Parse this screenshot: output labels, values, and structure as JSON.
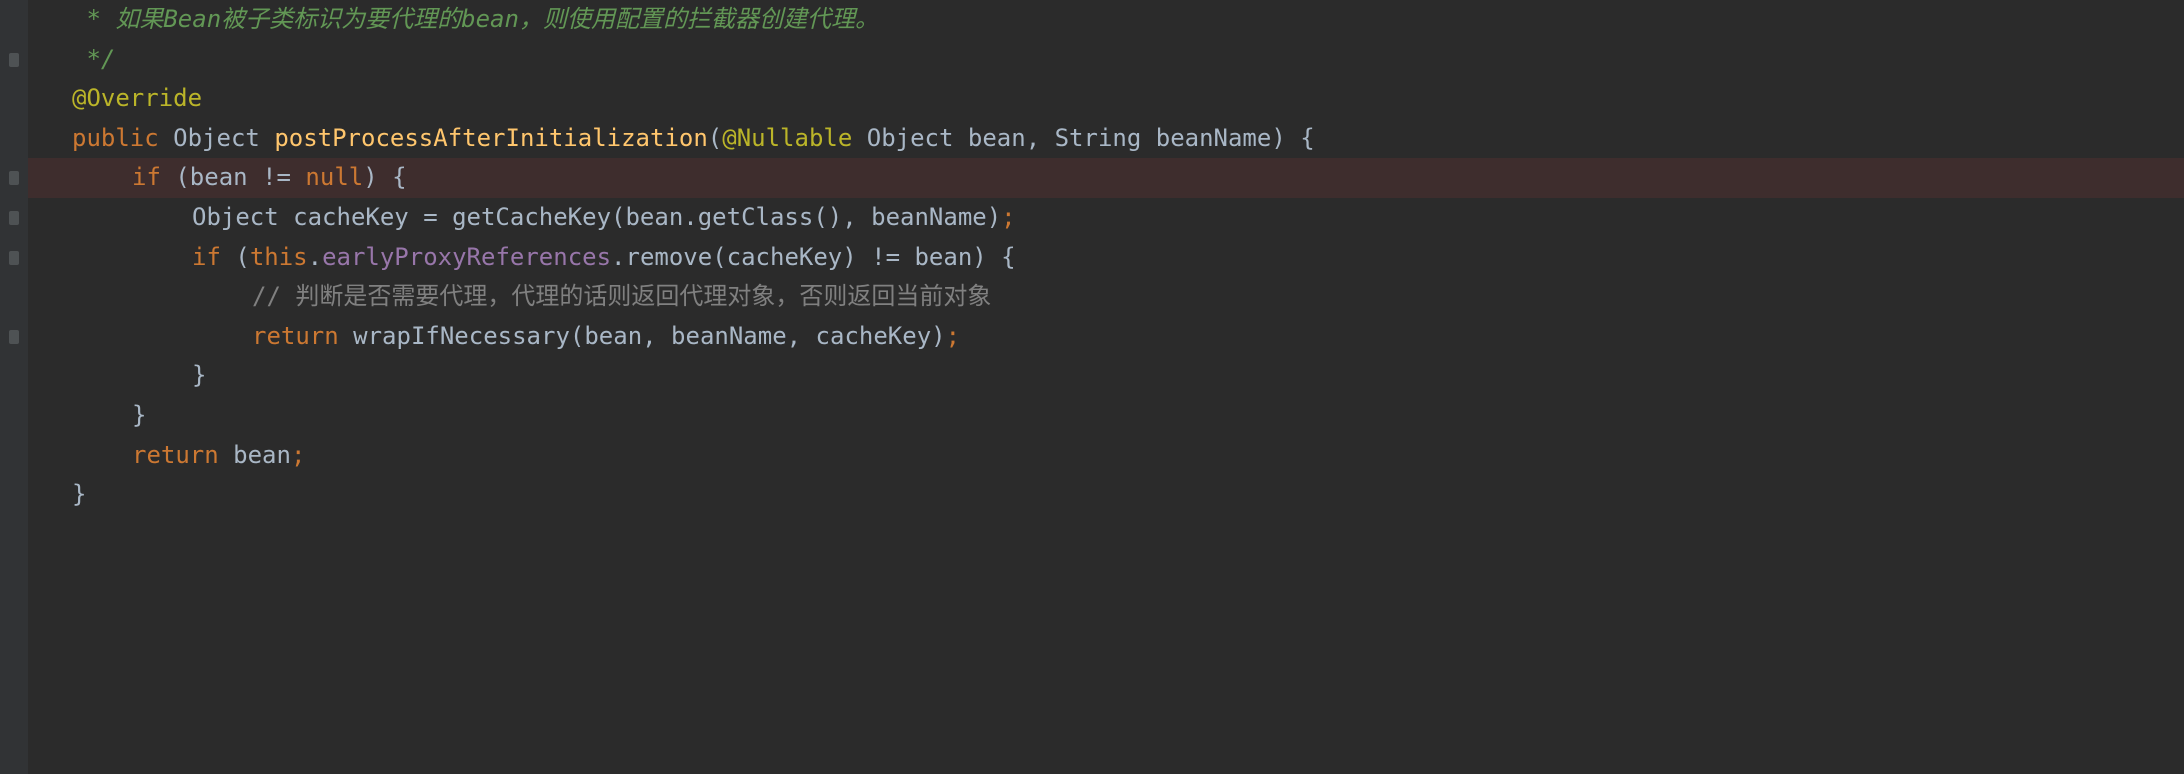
{
  "lines": [
    {
      "indent": 1,
      "segments": [
        {
          "cls": "comment-doc",
          "text": " * 如果Bean被子类标识为要代理的bean，则使用配置的拦截器创建代理。"
        }
      ]
    },
    {
      "indent": 1,
      "segments": [
        {
          "cls": "comment-doc",
          "text": " */"
        }
      ]
    },
    {
      "indent": 1,
      "segments": [
        {
          "cls": "annotation",
          "text": "@Override"
        }
      ]
    },
    {
      "indent": 1,
      "segments": [
        {
          "cls": "keyword",
          "text": "public "
        },
        {
          "cls": "type",
          "text": "Object "
        },
        {
          "cls": "method-decl",
          "text": "postProcessAfterInitialization"
        },
        {
          "cls": "paren",
          "text": "("
        },
        {
          "cls": "param-anno",
          "text": "@Nullable"
        },
        {
          "cls": "type",
          "text": " Object bean"
        },
        {
          "cls": "operator",
          "text": ", "
        },
        {
          "cls": "type",
          "text": "String beanName"
        },
        {
          "cls": "paren",
          "text": ") {"
        }
      ]
    },
    {
      "indent": 2,
      "highlighted": true,
      "segments": [
        {
          "cls": "keyword",
          "text": "if "
        },
        {
          "cls": "paren",
          "text": "(bean "
        },
        {
          "cls": "operator",
          "text": "!= "
        },
        {
          "cls": "null-kw",
          "text": "null"
        },
        {
          "cls": "paren",
          "text": ") {"
        }
      ]
    },
    {
      "indent": 3,
      "segments": [
        {
          "cls": "type",
          "text": "Object cacheKey = getCacheKey(bean.getClass()"
        },
        {
          "cls": "operator",
          "text": ", "
        },
        {
          "cls": "type",
          "text": "beanName)"
        },
        {
          "cls": "semicolon",
          "text": ";"
        }
      ]
    },
    {
      "indent": 3,
      "segments": [
        {
          "cls": "keyword",
          "text": "if "
        },
        {
          "cls": "paren",
          "text": "("
        },
        {
          "cls": "this-kw",
          "text": "this"
        },
        {
          "cls": "operator",
          "text": "."
        },
        {
          "cls": "field",
          "text": "earlyProxyReferences"
        },
        {
          "cls": "operator",
          "text": ".remove(cacheKey) != bean) {"
        }
      ]
    },
    {
      "indent": 4,
      "segments": [
        {
          "cls": "comment-line",
          "text": "// 判断是否需要代理，代理的话则返回代理对象，否则返回当前对象"
        }
      ]
    },
    {
      "indent": 4,
      "segments": [
        {
          "cls": "keyword",
          "text": "return "
        },
        {
          "cls": "method-call",
          "text": "wrapIfNecessary(bean"
        },
        {
          "cls": "operator",
          "text": ", "
        },
        {
          "cls": "method-call",
          "text": "beanName"
        },
        {
          "cls": "operator",
          "text": ", "
        },
        {
          "cls": "method-call",
          "text": "cacheKey)"
        },
        {
          "cls": "semicolon",
          "text": ";"
        }
      ]
    },
    {
      "indent": 3,
      "segments": [
        {
          "cls": "paren",
          "text": "}"
        }
      ]
    },
    {
      "indent": 2,
      "segments": [
        {
          "cls": "paren",
          "text": "}"
        }
      ]
    },
    {
      "indent": 2,
      "segments": [
        {
          "cls": "keyword",
          "text": "return "
        },
        {
          "cls": "type",
          "text": "bean"
        },
        {
          "cls": "semicolon",
          "text": ";"
        }
      ]
    },
    {
      "indent": 1,
      "segments": [
        {
          "cls": "paren",
          "text": "}"
        }
      ]
    }
  ],
  "gutter_marks": [
    1,
    4,
    5,
    6,
    8
  ],
  "indent_width": 60,
  "base_pad": 38
}
